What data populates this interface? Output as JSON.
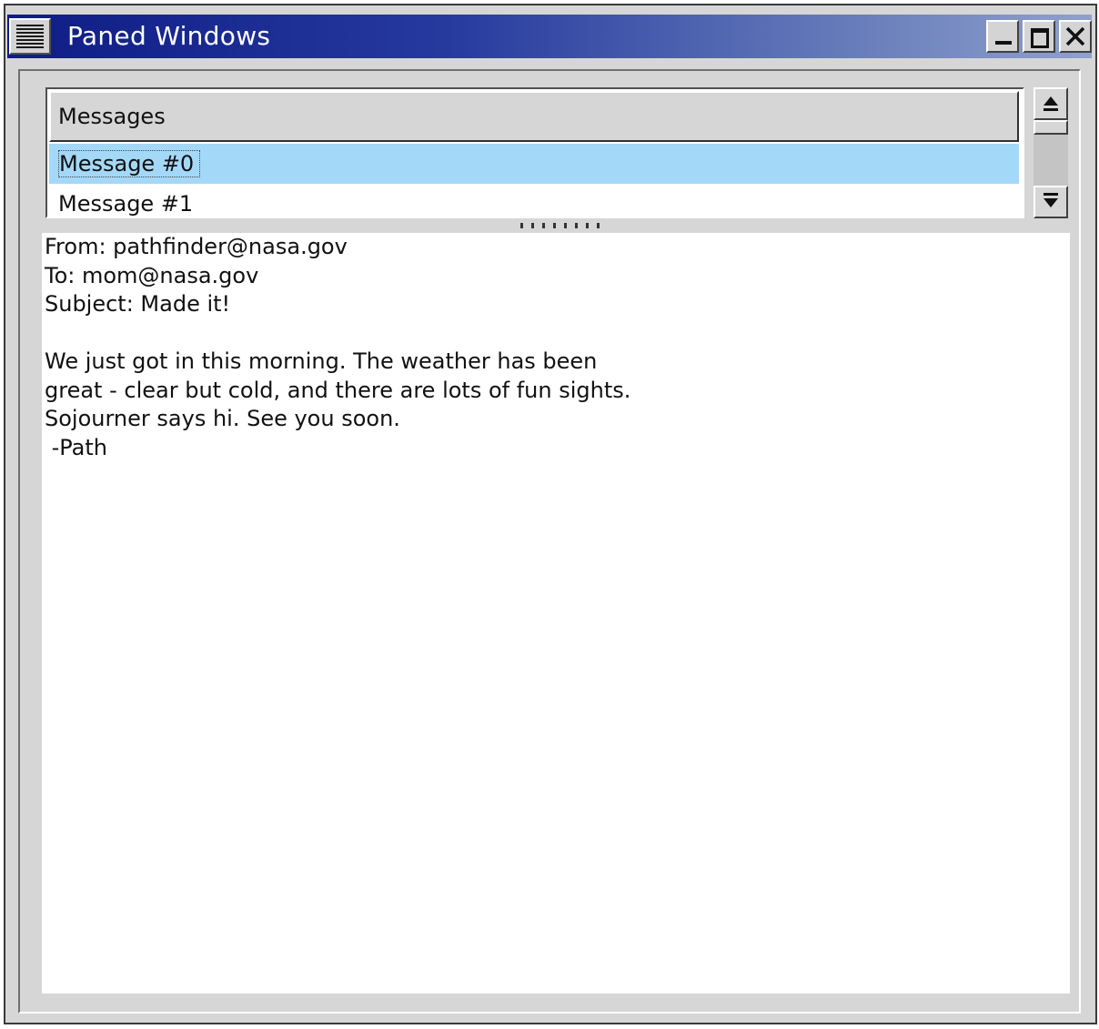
{
  "window": {
    "title": "Paned Windows",
    "controls": [
      "minimize",
      "maximize",
      "close"
    ]
  },
  "list": {
    "header": "Messages",
    "items": [
      "Message #0",
      "Message #1"
    ],
    "selected_index": 0
  },
  "message": {
    "lines": [
      "From: pathfinder@nasa.gov",
      "To: mom@nasa.gov",
      "Subject: Made it!",
      "",
      "We just got in this morning. The weather has been",
      "great - clear but cold, and there are lots of fun sights.",
      "Sojourner says hi. See you soon.",
      " -Path"
    ]
  },
  "colors": {
    "titlebar_start": "#0f1c86",
    "titlebar_end": "#8fa1cc",
    "selection": "#a4d8f8",
    "background": "#d6d6d6"
  },
  "icons": {
    "system_menu": "hamburger-lines-icon",
    "minimize": "minimize-icon",
    "maximize": "maximize-icon",
    "close": "close-icon",
    "scroll_up": "arrow-up-icon",
    "scroll_down": "arrow-down-icon"
  }
}
